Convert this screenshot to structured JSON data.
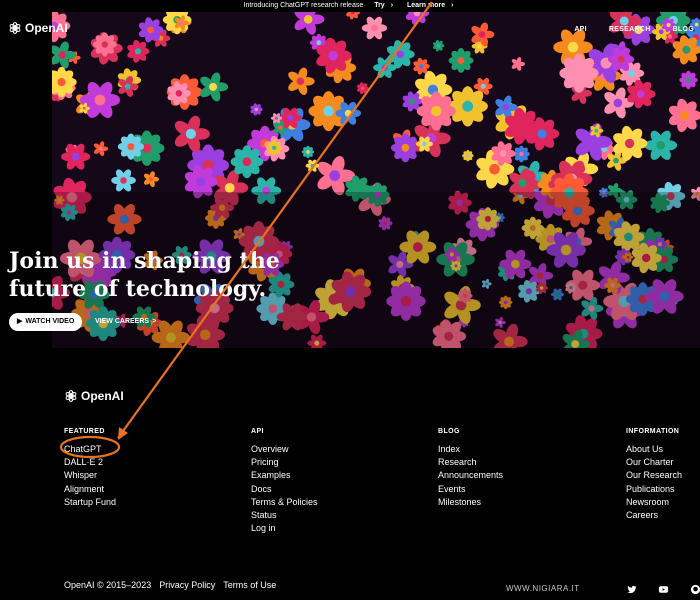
{
  "announcement": {
    "text": "Introducing ChatGPT research release",
    "try_label": "Try",
    "learn_label": "Learn more",
    "arrow": "›"
  },
  "brand": {
    "name": "OpenAI"
  },
  "nav": {
    "items": [
      "API",
      "RESEARCH",
      "BLOG"
    ]
  },
  "hero": {
    "title": "Join us in shaping the future of technology.",
    "watch_label": "WATCH VIDEO",
    "careers_label": "VIEW CAREERS",
    "careers_arrow": ">"
  },
  "footer": {
    "featured": {
      "heading": "FEATURED",
      "items": [
        "ChatGPT",
        "DALL·E 2",
        "Whisper",
        "Alignment",
        "Startup Fund"
      ]
    },
    "api": {
      "heading": "API",
      "items": [
        "Overview",
        "Pricing",
        "Examples",
        "Docs",
        "Terms & Policies",
        "Status",
        "Log in"
      ]
    },
    "blog": {
      "heading": "BLOG",
      "items": [
        "Index",
        "Research",
        "Announcements",
        "Events",
        "Milestones"
      ]
    },
    "information": {
      "heading": "INFORMATION",
      "items": [
        "About Us",
        "Our Charter",
        "Our Research",
        "Publications",
        "Newsroom",
        "Careers"
      ]
    },
    "copyright": "OpenAI © 2015–2023",
    "privacy": "Privacy Policy",
    "terms": "Terms of Use",
    "watermark": "WWW.NIGIARA.IT",
    "social": [
      "twitter-icon",
      "youtube-icon",
      "github-icon"
    ]
  },
  "annotation": {
    "color": "#e8731e"
  }
}
